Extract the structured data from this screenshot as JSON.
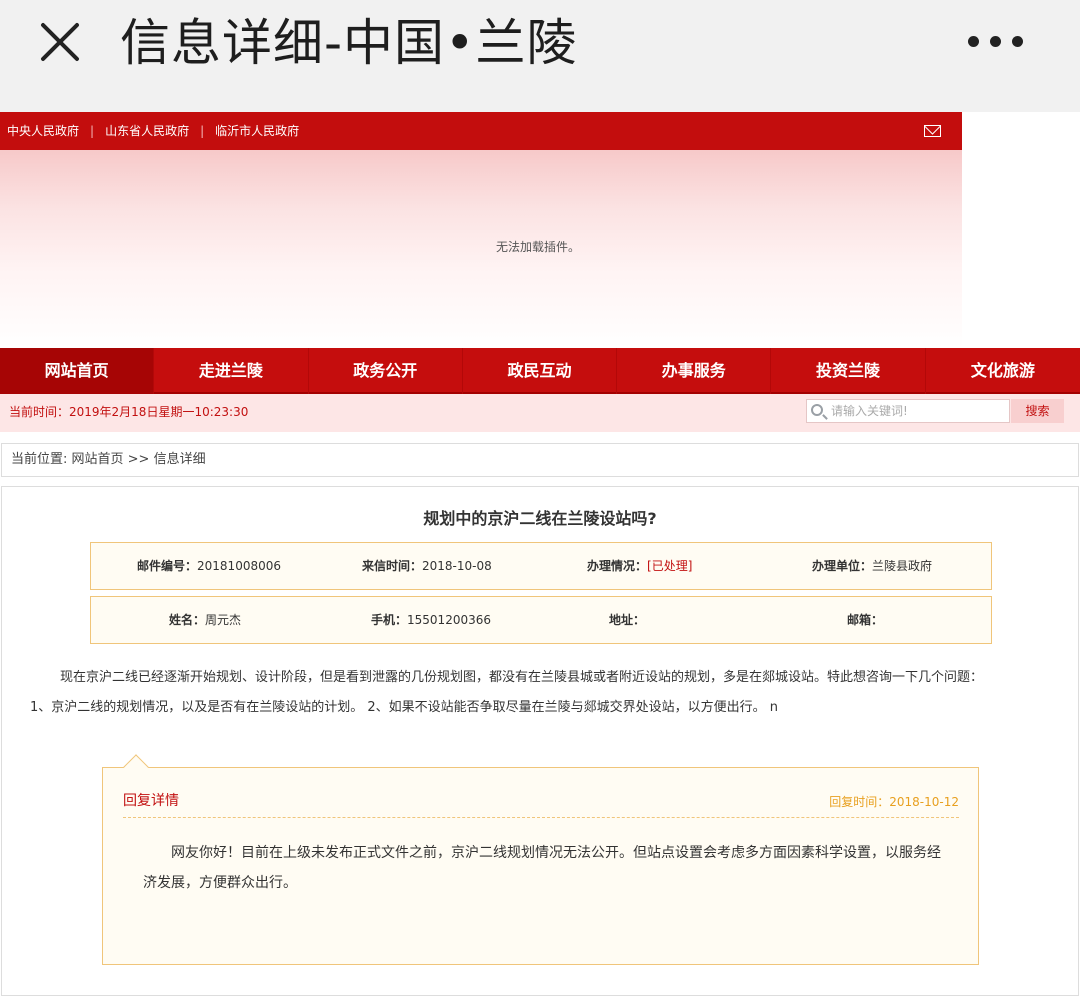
{
  "appbar": {
    "title": "信息详细-中国•兰陵"
  },
  "govbar": {
    "links": [
      "中央人民政府",
      "山东省人民政府",
      "临沂市人民政府"
    ],
    "separator": "|"
  },
  "banner": {
    "message": "无法加载插件。"
  },
  "nav": {
    "items": [
      "网站首页",
      "走进兰陵",
      "政务公开",
      "政民互动",
      "办事服务",
      "投资兰陵",
      "文化旅游"
    ]
  },
  "strip": {
    "time_label": "当前时间：2019年2月18日星期一10:23:30",
    "search_placeholder": "请输入关键词!",
    "search_button": "搜索"
  },
  "breadcrumb": {
    "prefix": "当前位置: ",
    "home": "网站首页",
    "sep": " >> ",
    "current": "信息详细"
  },
  "letter": {
    "subject": "规划中的京沪二线在兰陵设站吗?",
    "row1": {
      "mail_no_label": "邮件编号：",
      "mail_no": "20181008006",
      "date_label": "来信时间：",
      "date": "2018-10-08",
      "status_label": "办理情况：",
      "status": "[已处理]",
      "unit_label": "办理单位：",
      "unit": "兰陵县政府"
    },
    "row2": {
      "name_label": "姓名：",
      "name": "周元杰",
      "phone_label": "手机：",
      "phone": "15501200366",
      "address_label": "地址：",
      "address": "",
      "email_label": "邮箱：",
      "email": ""
    },
    "content_line1": "现在京沪二线已经逐渐开始规划、设计阶段，但是看到泄露的几份规划图，都没有在兰陵县城或者附近设站的规划，多是在郯城设站。特此想咨询一下几个问题：",
    "content_line2": "1、京沪二线的规划情况，以及是否有在兰陵设站的计划。 2、如果不设站能否争取尽量在兰陵与郯城交界处设站，以方便出行。 n"
  },
  "reply": {
    "label": "回复详情",
    "time": "回复时间：2018-10-12",
    "text": "网友你好！目前在上级未发布正式文件之前，京沪二线规划情况无法公开。但站点设置会考虑多方面因素科学设置，以服务经济发展，方便群众出行。"
  },
  "colors": {
    "brand_red": "#c50d0d",
    "accent_orange": "#e8a020",
    "panel_border": "#f0c57a"
  }
}
